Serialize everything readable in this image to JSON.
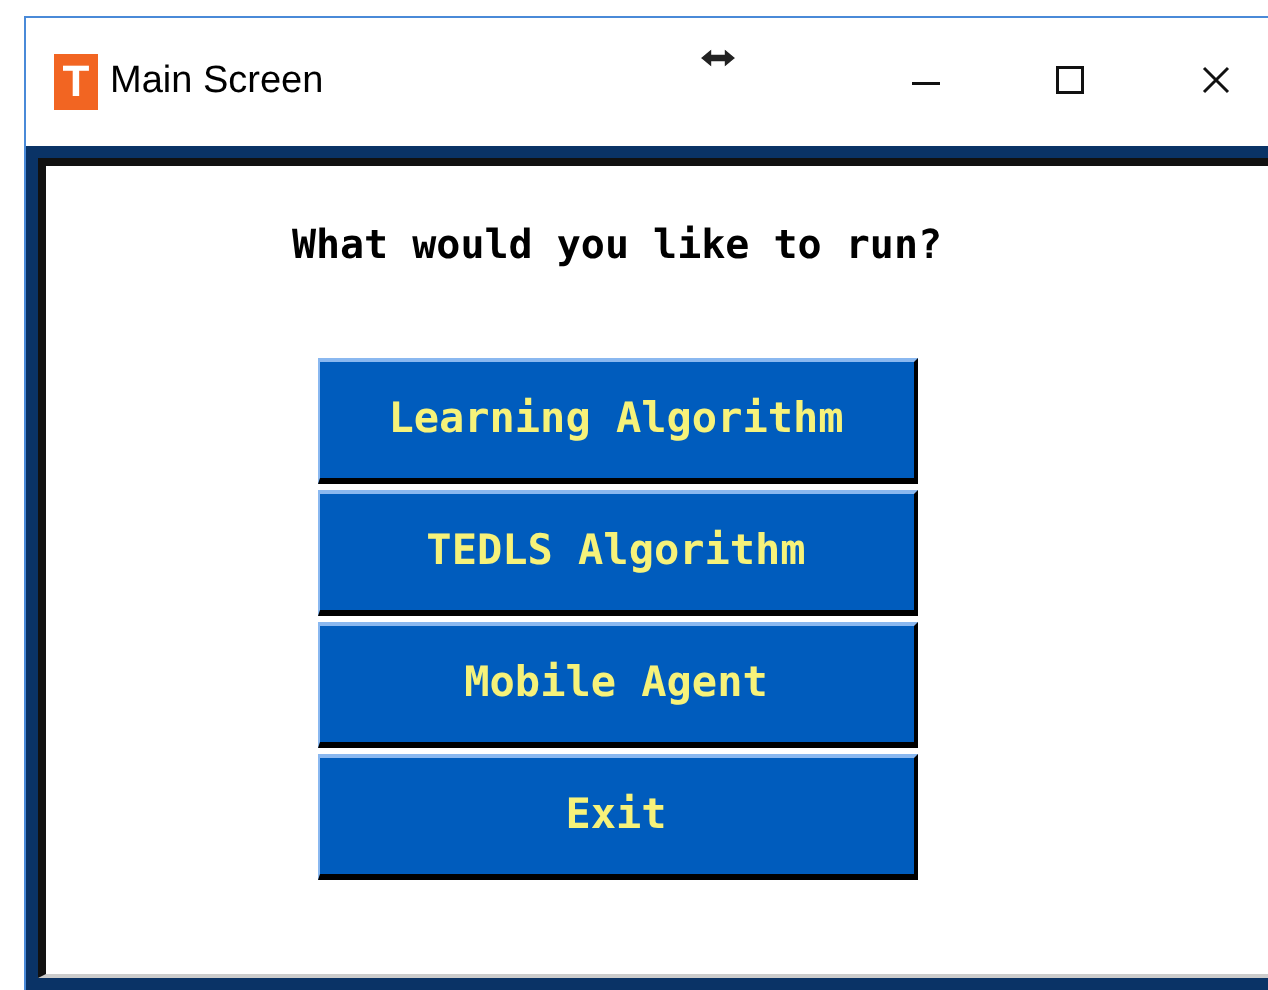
{
  "window": {
    "title": "Main Screen",
    "icon_letter": "T"
  },
  "prompt": "What would you like to run?",
  "buttons": [
    "Learning Algorithm",
    "TEDLS Algorithm",
    "Mobile Agent",
    "Exit"
  ]
}
